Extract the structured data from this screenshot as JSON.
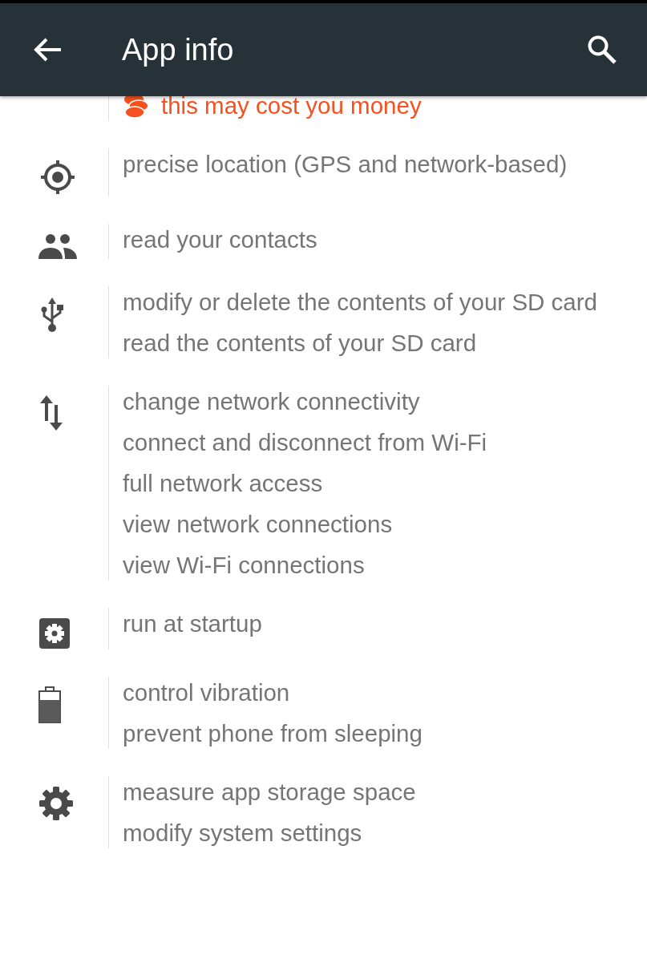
{
  "app_bar": {
    "title": "App info"
  },
  "permission_groups": [
    {
      "kind": "cost",
      "items": [
        "this may cost you money"
      ]
    },
    {
      "kind": "location",
      "items": [
        "precise location (GPS and network-based)"
      ]
    },
    {
      "kind": "contacts",
      "items": [
        "read your contacts"
      ]
    },
    {
      "kind": "storage",
      "items": [
        "modify or delete the contents of your SD card",
        "read the contents of your SD card"
      ]
    },
    {
      "kind": "network",
      "items": [
        "change network connectivity",
        "connect and disconnect from Wi-Fi",
        "full network access",
        "view network connections",
        "view Wi-Fi connections"
      ]
    },
    {
      "kind": "startup",
      "items": [
        "run at startup"
      ]
    },
    {
      "kind": "battery",
      "items": [
        "control vibration",
        "prevent phone from sleeping"
      ]
    },
    {
      "kind": "settings",
      "items": [
        "measure app storage space",
        "modify system settings"
      ]
    }
  ]
}
